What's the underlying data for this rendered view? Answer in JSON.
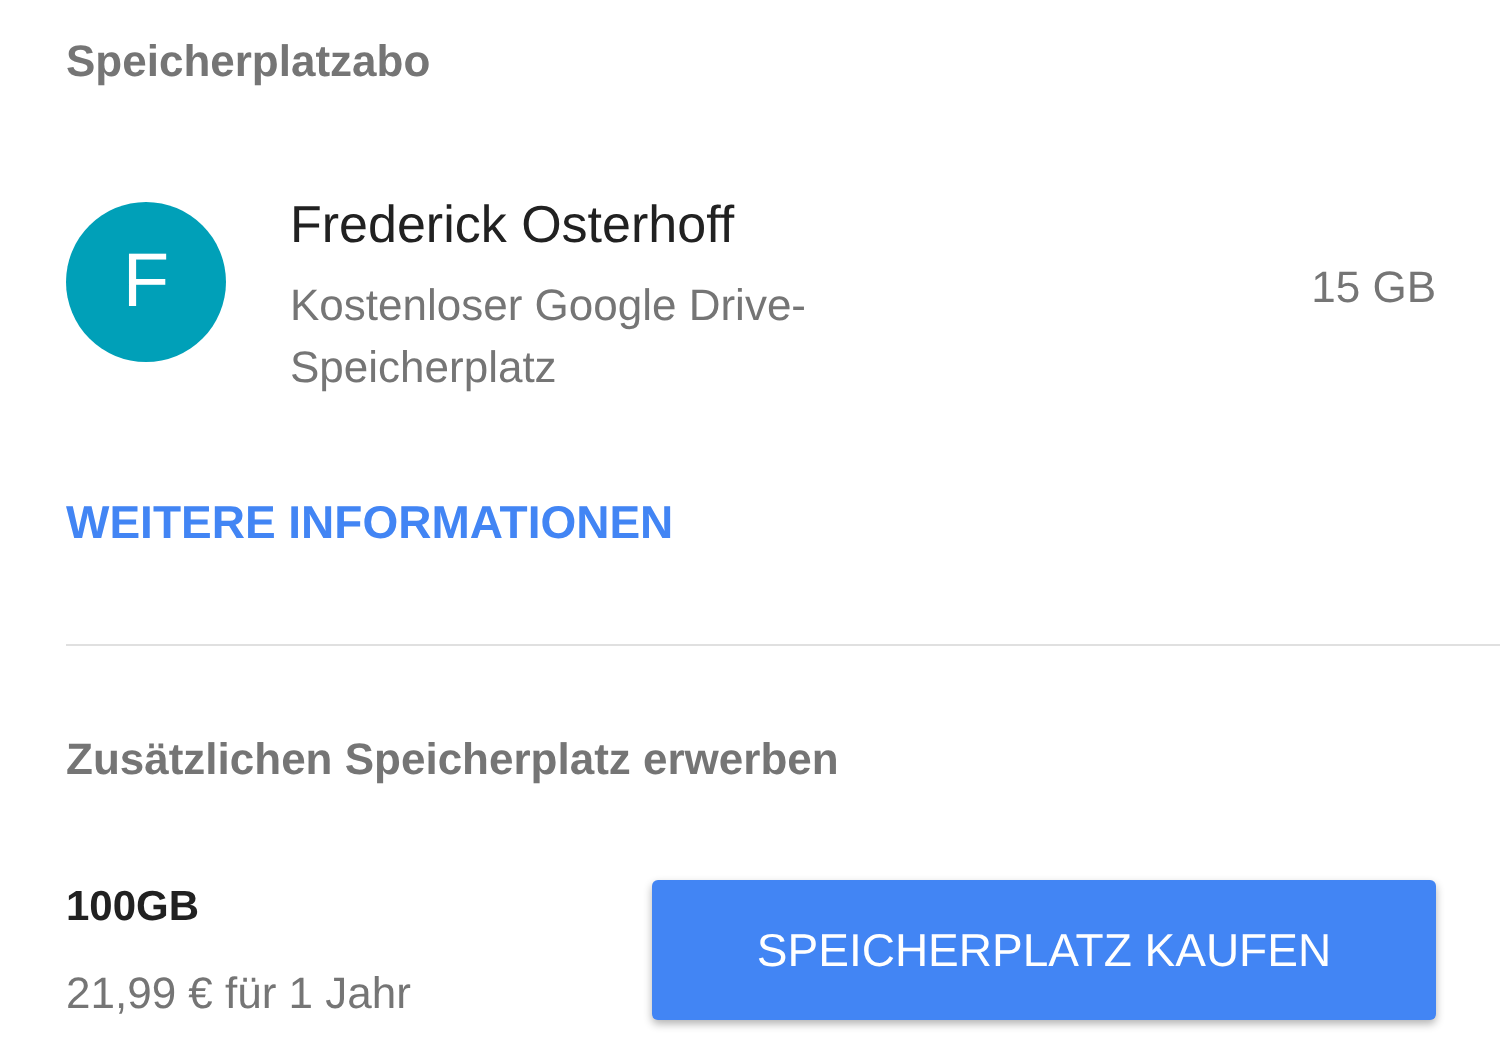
{
  "subscription": {
    "heading": "Speicherplatzabo",
    "account": {
      "avatar_letter": "F",
      "color": "#00a0b8",
      "name": "Frederick Osterhoff",
      "plan": "Kostenloser Google Drive-Speicherplatz",
      "quota": "15 GB"
    },
    "link": "WEITERE INFORMATIONEN"
  },
  "purchase": {
    "heading": "Zusätzlichen Speicherplatz erwerben",
    "offer": {
      "size": "100GB",
      "price": "21,99 € für 1 Jahr"
    },
    "button": "SPEICHERPLATZ KAUFEN"
  }
}
